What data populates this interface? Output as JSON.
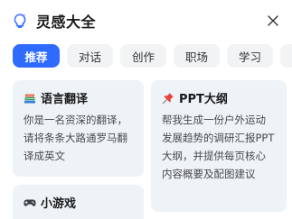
{
  "header": {
    "title": "灵感大全",
    "brand_icon": "bulb-sparkle-icon",
    "close_icon": "close-icon"
  },
  "tabs": [
    {
      "label": "推荐",
      "active": true
    },
    {
      "label": "对话",
      "active": false
    },
    {
      "label": "创作",
      "active": false
    },
    {
      "label": "职场",
      "active": false
    },
    {
      "label": "学习",
      "active": false
    }
  ],
  "cards": [
    {
      "icon": "books-icon",
      "title": "语言翻译",
      "desc": "你是一名资深的翻译，请将条条大路通罗马翻译成英文"
    },
    {
      "icon": "pushpin-icon",
      "title": "PPT大纲",
      "desc": "帮我生成一份户外运动发展趋势的调研汇报PPT大纲，并提供每页核心内容概要及配图建议"
    },
    {
      "icon": "gamepad-icon",
      "title": "小游戏",
      "desc": ""
    }
  ],
  "colors": {
    "accent": "#2f6bff",
    "tab_bg": "#f2f3f5",
    "card_bg": "#eef3f8"
  }
}
